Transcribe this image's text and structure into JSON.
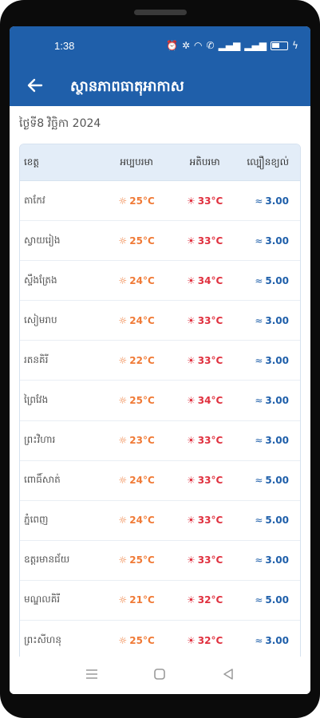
{
  "status_bar": {
    "time": "1:38"
  },
  "header": {
    "title": "ស្ថានភាពធាតុអាកាស"
  },
  "date_text": "ថ្ងៃទី8 វិច្ឆិកា 2024",
  "table": {
    "columns": [
      "ខេត្ត",
      "អប្បបរមា",
      "អតិបរមា",
      "ល្បឿនខ្យល់"
    ],
    "rows": [
      {
        "province": "តាកែវ",
        "min": "25°C",
        "max": "33°C",
        "wind": "3.00"
      },
      {
        "province": "ស្វាយរៀង",
        "min": "25°C",
        "max": "33°C",
        "wind": "3.00"
      },
      {
        "province": "ស្ទឹងត្រែង",
        "min": "24°C",
        "max": "34°C",
        "wind": "5.00"
      },
      {
        "province": "សៀមរាប",
        "min": "24°C",
        "max": "33°C",
        "wind": "3.00"
      },
      {
        "province": "រតនគិរី",
        "min": "22°C",
        "max": "33°C",
        "wind": "3.00"
      },
      {
        "province": "ព្រៃវែង",
        "min": "25°C",
        "max": "34°C",
        "wind": "3.00"
      },
      {
        "province": "ព្រះវិហារ",
        "min": "23°C",
        "max": "33°C",
        "wind": "3.00"
      },
      {
        "province": "ពោធិ៍សាត់",
        "min": "24°C",
        "max": "33°C",
        "wind": "5.00"
      },
      {
        "province": "ភ្នំពេញ",
        "min": "24°C",
        "max": "33°C",
        "wind": "5.00"
      },
      {
        "province": "ឧត្តរមានជ័យ",
        "min": "25°C",
        "max": "33°C",
        "wind": "3.00"
      },
      {
        "province": "មណ្ឌលគិរី",
        "min": "21°C",
        "max": "32°C",
        "wind": "5.00"
      },
      {
        "province": "ព្រះសីហនុ",
        "min": "25°C",
        "max": "32°C",
        "wind": "3.00"
      }
    ]
  },
  "icons": {
    "min": "sun-cold-icon",
    "max": "sun-hot-icon",
    "wind": "wind-icon"
  },
  "colors": {
    "primary": "#1f5faa",
    "min_temp": "#f07a36",
    "max_temp": "#e0303e",
    "wind": "#1f5faa"
  }
}
